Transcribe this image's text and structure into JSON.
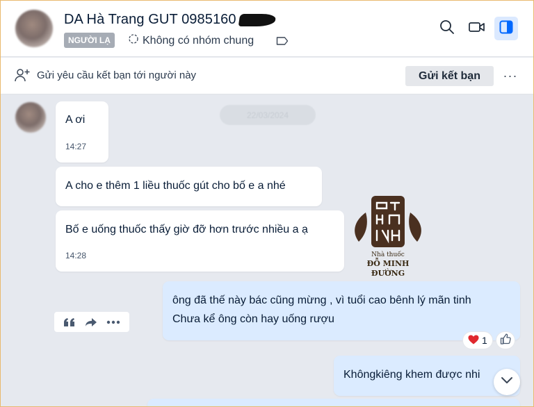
{
  "header": {
    "contact_name": "DA Hà Trang GUT  0985160",
    "badge": "NGƯỜI LẠ",
    "group_text": "Không có nhóm chung"
  },
  "friend_bar": {
    "text": "Gửi yêu cầu kết bạn tới người này",
    "button": "Gửi kết bạn",
    "more": "···"
  },
  "date_pill": "22/03/2024",
  "messages": [
    {
      "text": "A ơi",
      "time": "14:27"
    },
    {
      "text": "A cho e thêm 1 liều thuốc gút cho bố e a nhé"
    },
    {
      "text": "Bố e uống thuốc thấy giờ đỡ hơn trước nhiều a ạ",
      "time": "14:28"
    },
    {
      "line1": "ông đã thế này bác cũng mừng , vì tuổi cao bênh lý mãn tinh",
      "line2": "Chưa kể ông còn hay uống rượu"
    },
    {
      "text": "Khôngkiêng khem được nhi"
    }
  ],
  "reactions": {
    "heart_count": "1"
  },
  "logo": {
    "line1": "Nhà thuốc",
    "line2": "ĐỖ MINH ĐƯỜNG"
  },
  "colors": {
    "accent": "#0068ff",
    "outgoing_bubble": "#dbebff",
    "brown": "#4a3020"
  }
}
